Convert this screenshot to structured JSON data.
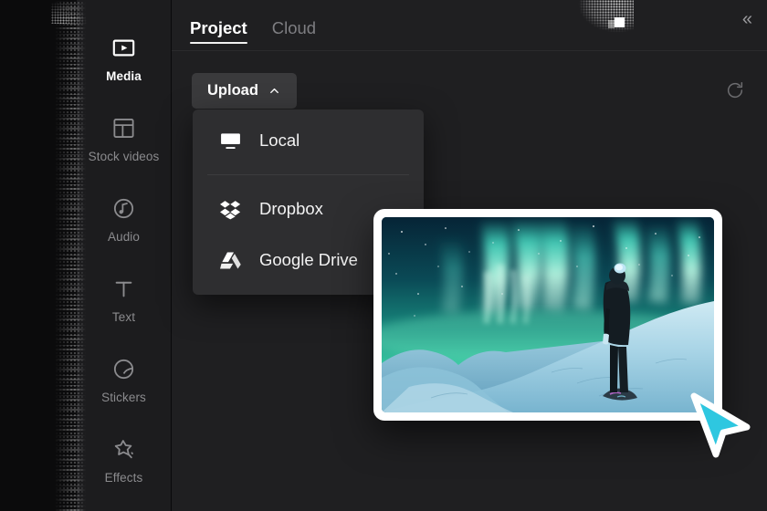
{
  "app": {
    "accent_cyan": "#2ec7e0",
    "panel_bg": "#1f1f21",
    "rail_bg": "#1c1c1e",
    "dropdown_bg": "#2e2e30"
  },
  "sidebar": {
    "items": [
      {
        "label": "Media",
        "icon": "media-play-rectangle-icon",
        "active": true
      },
      {
        "label": "Stock videos",
        "icon": "layout-grid-icon",
        "active": false
      },
      {
        "label": "Audio",
        "icon": "audio-note-circle-icon",
        "active": false
      },
      {
        "label": "Text",
        "icon": "text-t-icon",
        "active": false
      },
      {
        "label": "Stickers",
        "icon": "sticker-peel-icon",
        "active": false
      },
      {
        "label": "Effects",
        "icon": "effects-star-icon",
        "active": false
      }
    ]
  },
  "panel": {
    "tabs": [
      {
        "label": "Project",
        "active": true
      },
      {
        "label": "Cloud",
        "active": false
      }
    ],
    "collapse_label": "«",
    "collapse_icon": "chevron-double-left-icon"
  },
  "toolbar": {
    "upload_label": "Upload",
    "upload_chevron_icon": "chevron-up-icon",
    "refresh_icon": "refresh-icon"
  },
  "upload_menu": {
    "items": [
      {
        "label": "Local",
        "icon": "monitor-icon"
      },
      {
        "label": "Dropbox",
        "icon": "dropbox-icon"
      },
      {
        "label": "Google Drive",
        "icon": "google-drive-icon"
      }
    ]
  },
  "thumbnail": {
    "alt": "aurora-borealis-photo",
    "description": "Person standing on snowy ridge beneath green aurora borealis"
  },
  "cursor": {
    "icon": "pointer-arrow-cursor",
    "color": "#2ec7e0"
  }
}
